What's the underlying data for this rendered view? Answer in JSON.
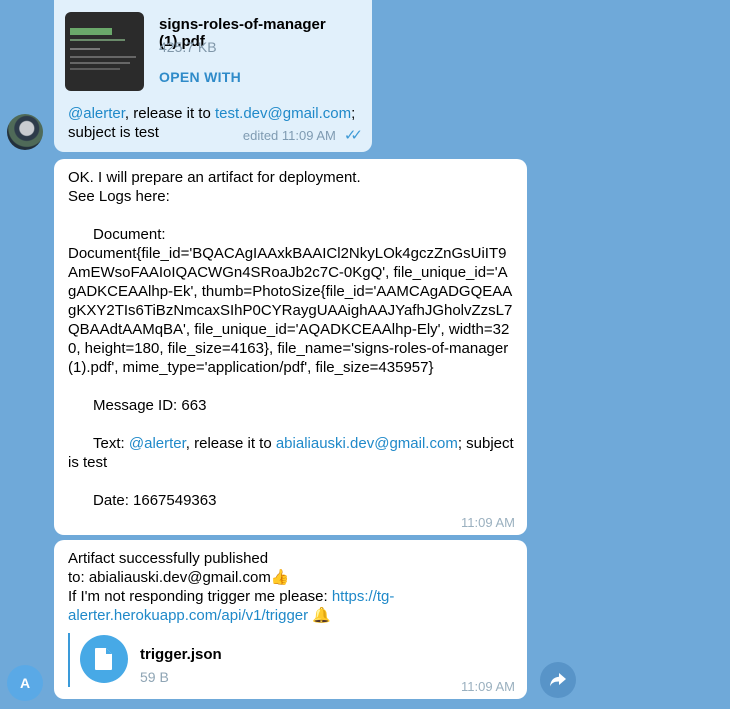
{
  "msg1": {
    "file_name": "signs-roles-of-manager (1).pdf",
    "file_size": "425.7 KB",
    "open_with": "OPEN WITH",
    "mention": "@alerter",
    "text_a": ", release it to ",
    "email": "test.dev@gmail.com",
    "text_b": ";",
    "text_c": "subject is test",
    "edited_time": "edited 11:09 AM"
  },
  "msg2": {
    "line1": "OK. I will prepare an artifact for deployment.",
    "line2": "See Logs here:",
    "document_block": "      Document:\nDocument{file_id='BQACAgIAAxkBAAICl2NkyLOk4gczZnGsUiIT9AmEWsoFAAIoIQACWGn4SRoaJb2c7C-0KgQ', file_unique_id='AgADKCEAAlhp-Ek', thumb=PhotoSize{file_id='AAMCAgADGQEAAgKXY2TIs6TiBzNmcaxSIhP0CYRaygUAAighAAJYafhJGholvZzsL7QBAAdtAAMqBA', file_unique_id='AQADKCEAAlhp-Ely', width=320, height=180, file_size=4163}, file_name='signs-roles-of-manager (1).pdf', mime_type='application/pdf', file_size=435957}",
    "message_id": "      Message ID: 663",
    "text_label": "      Text: ",
    "mention": "@alerter",
    "text_mid": ", release it to ",
    "email": "abialiauski.dev@gmail.com",
    "text_end": "; subject is test",
    "date": "      Date: 1667549363",
    "time": "11:09 AM"
  },
  "msg3": {
    "line1": "Artifact successfully published",
    "line2": "to: abialiauski.dev@gmail.com",
    "emoji_thumb": "👍",
    "line3": "If I'm not responding trigger me please: ",
    "url": "https://tg-alerter.herokuapp.com/api/v1/trigger",
    "emoji_bell": "🔔",
    "file_name": "trigger.json",
    "file_size": "59 B",
    "time": "11:09 AM"
  },
  "avatar_a": "A",
  "icons": [
    "pdf-thumbnail",
    "file-icon",
    "share-icon",
    "double-check-icon"
  ],
  "colors": {
    "background": "#6fa9d9",
    "outgoing": "#e1f0fb",
    "incoming": "#ffffff",
    "link": "#1f89c9"
  }
}
